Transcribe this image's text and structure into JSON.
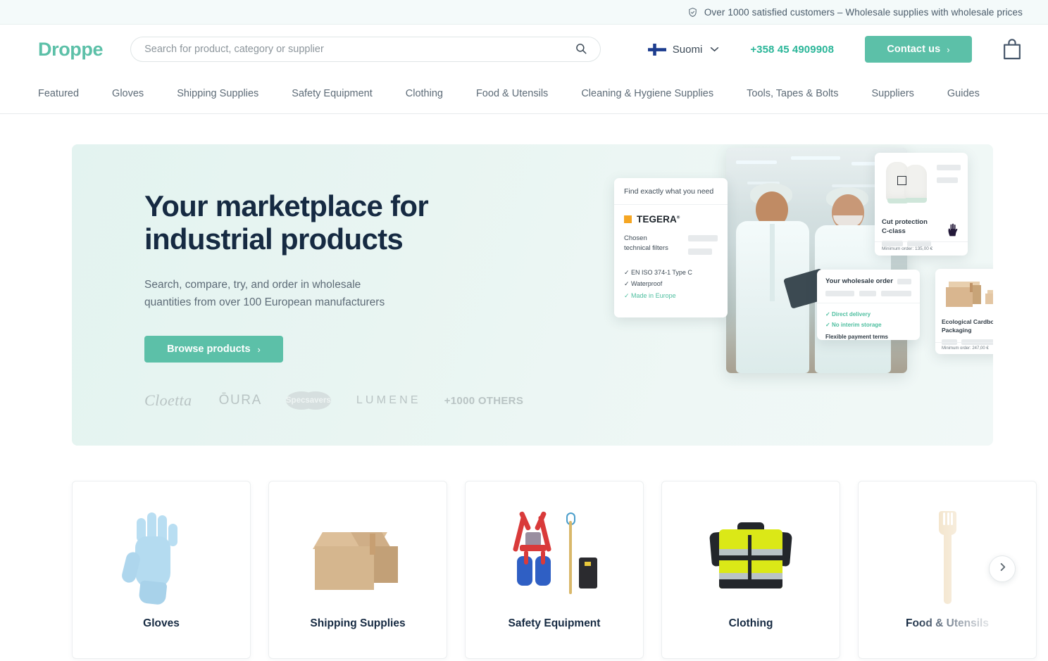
{
  "topbar": {
    "icon": "shield-check-icon",
    "text": "Over 1000 satisfied customers – Wholesale supplies with wholesale prices"
  },
  "header": {
    "logo": "Droppe",
    "search": {
      "placeholder": "Search for product, category or supplier",
      "value": "",
      "icon": "search-icon"
    },
    "language": {
      "label": "Suomi",
      "flag": "finland-flag-icon",
      "chevron": "chevron-down-icon"
    },
    "phone": "+358 45 4909908",
    "contact_button": {
      "label": "Contact us",
      "arrow": "›"
    },
    "cart_icon": "shopping-bag-icon",
    "accent_color": "#5cc0a8",
    "phone_color": "#2bb699"
  },
  "nav": {
    "items": [
      "Featured",
      "Gloves",
      "Shipping Supplies",
      "Safety Equipment",
      "Clothing",
      "Food & Utensils",
      "Cleaning & Hygiene Supplies",
      "Tools, Tapes & Bolts",
      "Suppliers",
      "Guides"
    ]
  },
  "hero": {
    "title_line1": "Your marketplace for",
    "title_line2": "industrial products",
    "subtitle": "Search, compare, try, and order in wholesale quantities from over 100 European manufacturers",
    "cta": {
      "label": "Browse products",
      "arrow": "›"
    },
    "brands": [
      "Cloetta",
      "ŌURA",
      "Specsavers",
      "LUMENE",
      "+1000 OTHERS"
    ],
    "background_color": "#e6f4f1"
  },
  "collage": {
    "find_card": {
      "header": "Find exactly what you need",
      "brand": "TEGERA",
      "brand_mark": "®",
      "label_line1": "Chosen",
      "label_line2": "technical filters",
      "checks": [
        {
          "text": "EN ISO 374-1 Type C",
          "highlight": false
        },
        {
          "text": "Waterproof",
          "highlight": false
        },
        {
          "text": "Made in Europe",
          "highlight": true
        }
      ]
    },
    "cut_card": {
      "title_line1": "Cut protection",
      "title_line2": "C-class",
      "minimum_order": "Minimum order: 135,00 €"
    },
    "order_card": {
      "title": "Your wholesale order",
      "items": [
        {
          "text": "Direct delivery",
          "highlight": true
        },
        {
          "text": "No interim storage",
          "highlight": true
        },
        {
          "text": "Flexible payment terms",
          "highlight": false
        }
      ]
    },
    "packaging_card": {
      "title_line1": "Ecological Cardboard",
      "title_line2": "Packaging",
      "minimum_order": "Minimum order: 247,00 €"
    },
    "photo_alt": "two-workers-in-white-coats-with-tablet"
  },
  "categories": {
    "next_icon": "chevron-right-icon",
    "items": [
      {
        "label": "Gloves",
        "image": "blue-nitrile-glove"
      },
      {
        "label": "Shipping Supplies",
        "image": "cardboard-box"
      },
      {
        "label": "Safety Equipment",
        "image": "fall-arrest-harness-kit"
      },
      {
        "label": "Clothing",
        "image": "hi-vis-jacket"
      },
      {
        "label": "Food & Utensils",
        "image": "wooden-fork"
      }
    ]
  }
}
